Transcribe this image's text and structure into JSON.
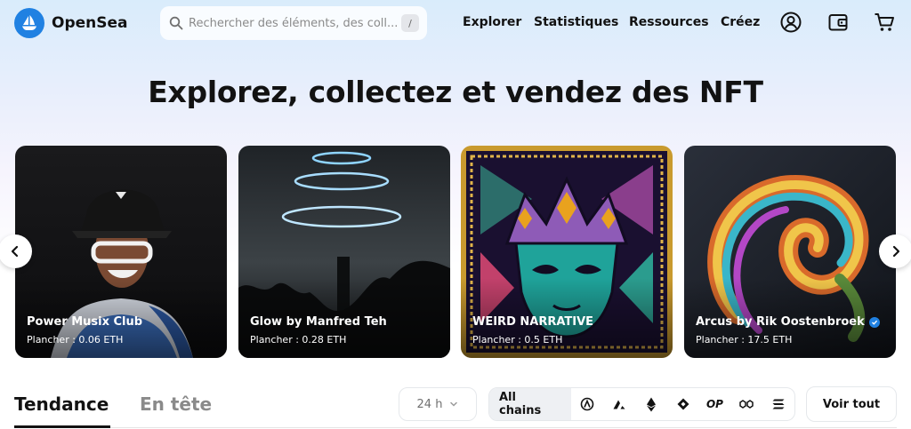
{
  "brand": {
    "name": "OpenSea",
    "color": "#2081e2",
    "logo_icon": "sailboat-icon"
  },
  "search": {
    "placeholder": "Rechercher des éléments, des coll...",
    "value": "",
    "shortcut": "/"
  },
  "nav": {
    "items": [
      {
        "label": "Explorer"
      },
      {
        "label": "Statistiques"
      },
      {
        "label": "Ressources"
      },
      {
        "label": "Créez"
      }
    ],
    "icons": [
      "account-icon",
      "wallet-icon",
      "cart-icon"
    ]
  },
  "hero": {
    "title": "Explorez, collectez et vendez des NFT"
  },
  "carousel": {
    "prev_icon": "chevron-left-icon",
    "next_icon": "chevron-right-icon",
    "cards": [
      {
        "name": "Power Musix Club",
        "floor": "Plancher : 0.06 ETH",
        "verified": false
      },
      {
        "name": "Glow by Manfred Teh",
        "floor": "Plancher : 0.28 ETH",
        "verified": false
      },
      {
        "name": "WEIRD NARRATIVE",
        "floor": "Plancher : 0.5 ETH",
        "verified": false
      },
      {
        "name": "Arcus by Rik Oostenbroek",
        "floor": "Plancher : 17.5 ETH",
        "verified": true
      }
    ]
  },
  "trending": {
    "tabs": [
      {
        "label": "Tendance",
        "active": true
      },
      {
        "label": "En tête",
        "active": false
      }
    ],
    "period": {
      "value": "24 h"
    },
    "chains": {
      "all_label": "All chains",
      "icons": [
        "arbitrum-icon",
        "avalanche-icon",
        "ethereum-icon",
        "klaytn-icon",
        "optimism-icon",
        "polygon-icon",
        "solana-icon"
      ],
      "op_label": "OP"
    },
    "view_all": "Voir tout"
  }
}
